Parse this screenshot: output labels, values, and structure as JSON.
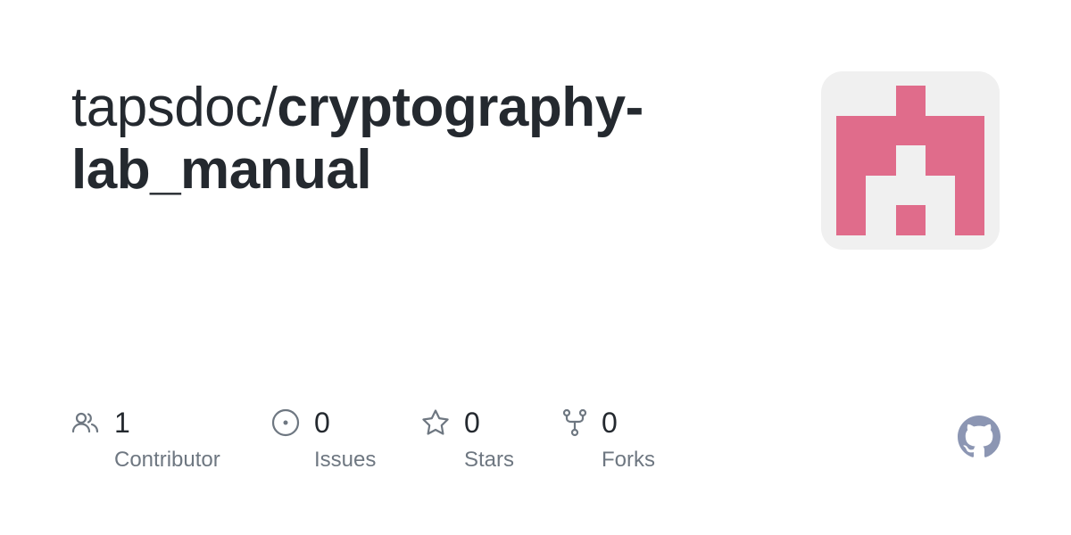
{
  "repo": {
    "owner": "tapsdoc/",
    "name": "cryptography-lab_manual"
  },
  "avatar": {
    "icon": "identicon-avatar",
    "color": "#e06c8b",
    "background": "#f0f0f0"
  },
  "stats": {
    "contributors": {
      "count": "1",
      "label": "Contributor",
      "icon": "people-icon"
    },
    "issues": {
      "count": "0",
      "label": "Issues",
      "icon": "issue-opened-icon"
    },
    "stars": {
      "count": "0",
      "label": "Stars",
      "icon": "star-icon"
    },
    "forks": {
      "count": "0",
      "label": "Forks",
      "icon": "repo-forked-icon"
    }
  },
  "branding": {
    "logo": "github-logo-icon",
    "logo_color": "#8c96b3"
  }
}
